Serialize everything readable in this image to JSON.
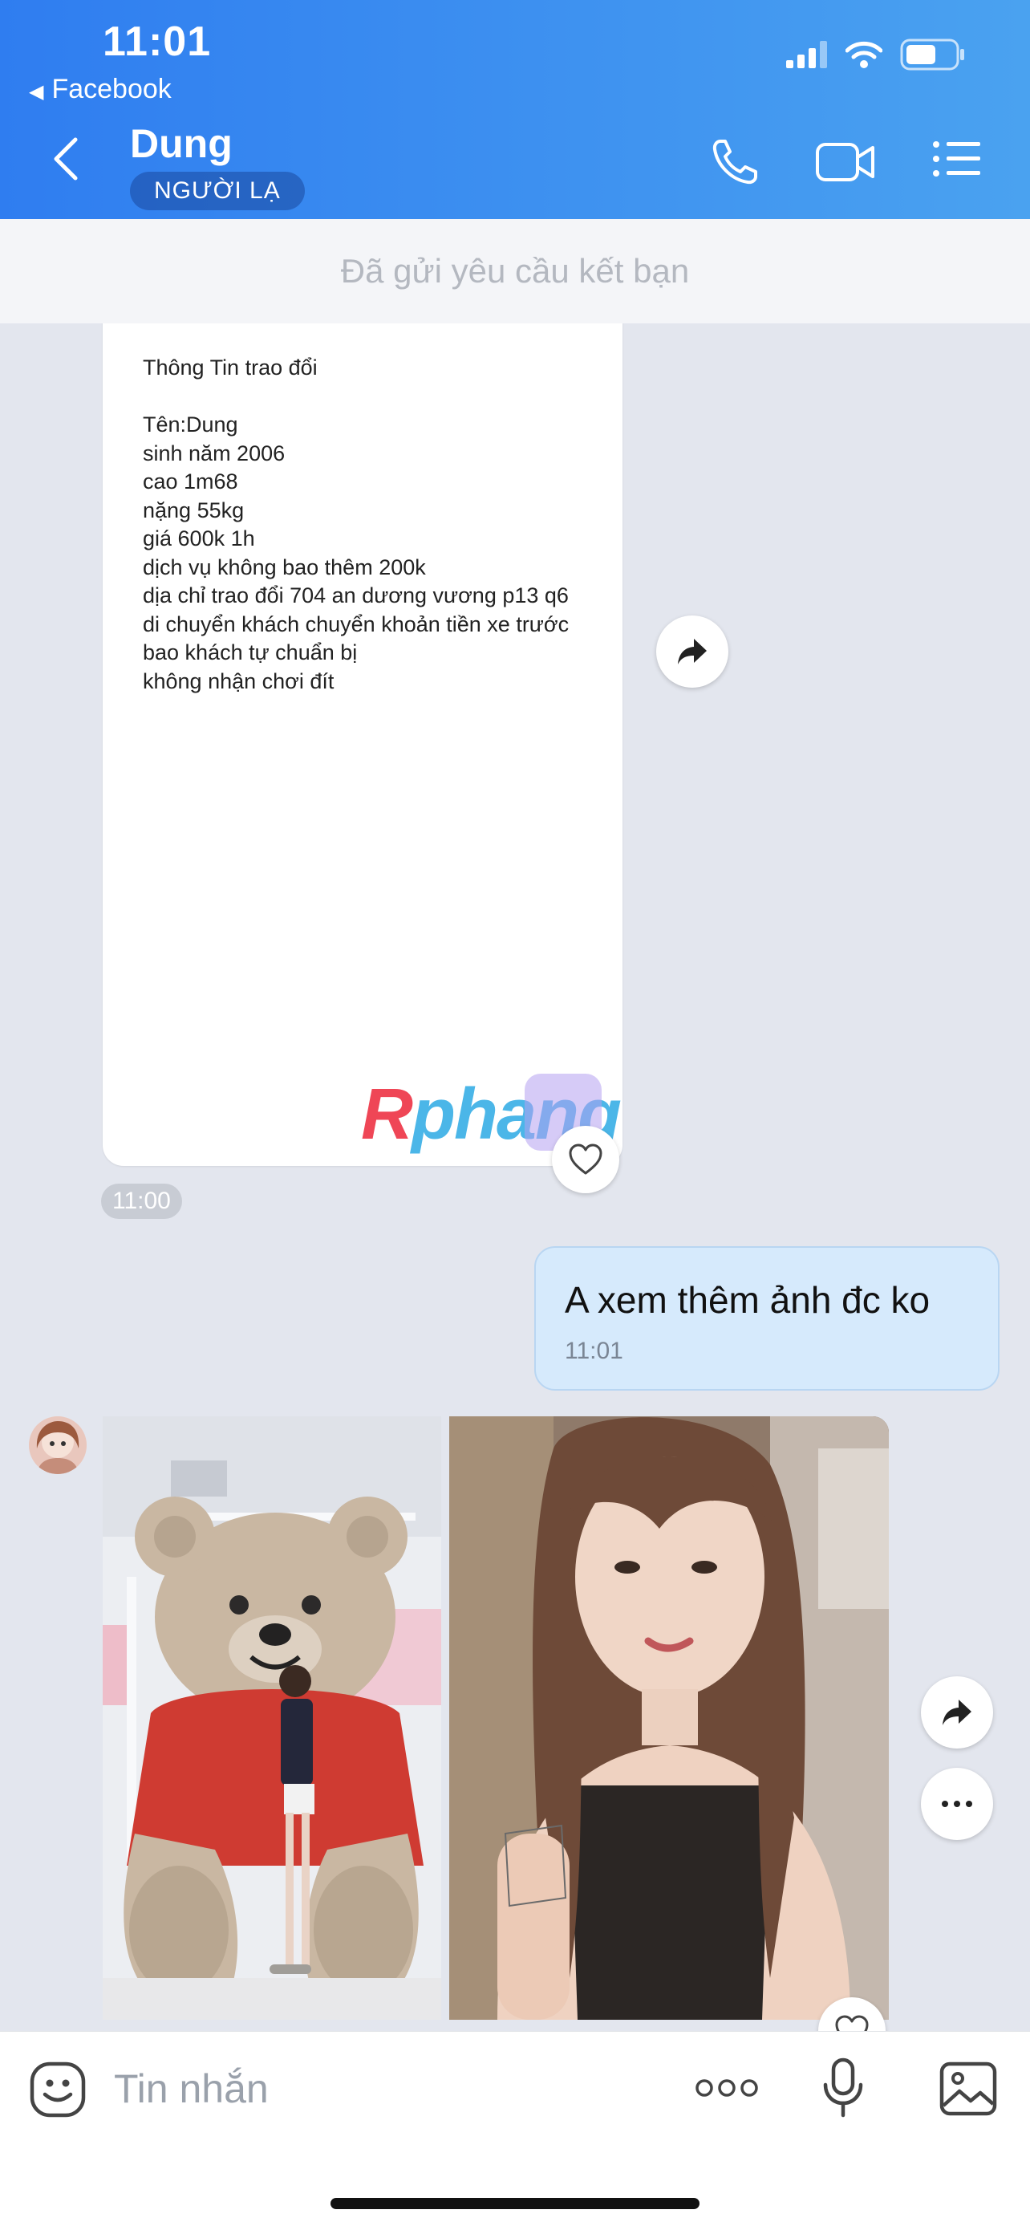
{
  "status_bar": {
    "time": "11:01",
    "back_app": "Facebook"
  },
  "header": {
    "name": "Dung",
    "badge": "NGƯỜI LẠ"
  },
  "friend_request": "Đã gửi yêu cầu kết bạn",
  "document_message": {
    "text": "Thông Tin trao đổi\n\nTên:Dung\nsinh năm 2006\ncao 1m68\nnặng 55kg\ngiá 600k 1h\ndịch vụ không bao thêm 200k\ndịa chỉ trao đổi 704 an dương vương p13 q6\ndi chuyển khách chuyển khoản tiền xe trước\nbao khách tự chuẩn bị\nkhông nhận chơi đít",
    "time": "11:00"
  },
  "watermark": {
    "part1": "R",
    "part2": "phang"
  },
  "outgoing_message": {
    "text": "A xem thêm ảnh đc ko",
    "time": "11:01"
  },
  "composer": {
    "placeholder": "Tin nhắn"
  },
  "colors": {
    "header_start": "#2f7df0",
    "header_end": "#4aa2f0",
    "outgoing_bubble": "#d6eafc",
    "chat_bg": "#e3e6ee"
  }
}
